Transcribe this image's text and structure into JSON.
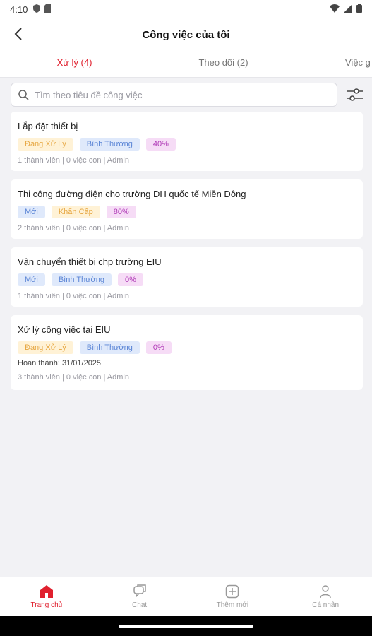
{
  "status": {
    "time": "4:10"
  },
  "header": {
    "title": "Công việc của tôi"
  },
  "tabs": [
    {
      "label": "Xử lý (4)",
      "active": true
    },
    {
      "label": "Theo dõi (2)",
      "active": false
    },
    {
      "label": "Việc g",
      "active": false
    }
  ],
  "search": {
    "placeholder": "Tìm theo tiêu đề công việc",
    "value": ""
  },
  "tasks": [
    {
      "title": "Lắp đặt thiết bị",
      "badges": [
        "Đang Xử Lý",
        "Bình Thường",
        "40%"
      ],
      "meta": "1 thành viên  |  0 việc con  |  Admin"
    },
    {
      "title": "Thi công đường điện cho trường ĐH quốc tế Miền Đông",
      "badges": [
        "Mới",
        "Khẩn Cấp",
        "80%"
      ],
      "meta": "2 thành viên  |  0 việc con  |  Admin"
    },
    {
      "title": "Vận chuyển thiết bị chp trường EIU",
      "badges": [
        "Mới",
        "Bình Thường",
        "0%"
      ],
      "meta": "1 thành viên  |  0 việc con  |  Admin"
    },
    {
      "title": "Xử lý công việc tại EIU",
      "badges": [
        "Đang Xử Lý",
        "Bình Thường",
        "0%"
      ],
      "done": "Hoàn thành: 31/01/2025",
      "meta": "3 thành viên  |  0 việc con  |  Admin"
    }
  ],
  "bottom_nav": [
    {
      "label": "Trang chủ",
      "icon": "home-icon",
      "active": true
    },
    {
      "label": "Chat",
      "icon": "chat-icon",
      "active": false
    },
    {
      "label": "Thêm mới",
      "icon": "add-icon",
      "active": false
    },
    {
      "label": "Cá nhân",
      "icon": "person-icon",
      "active": false
    }
  ],
  "colors": {
    "accent": "#e0202e",
    "background": "#f2f2f5"
  }
}
